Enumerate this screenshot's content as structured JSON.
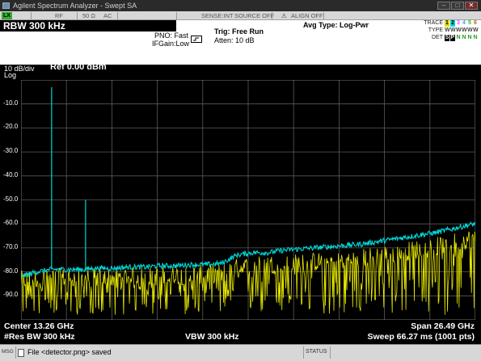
{
  "window": {
    "title": "Agilent Spectrum Analyzer - Swept SA"
  },
  "status_row": {
    "tag": "LX",
    "rf": "RF",
    "impedance": "50 Ω",
    "coupling": "AC",
    "sense": "SENSE:INT",
    "source": "SOURCE OFF",
    "align": "ALIGN OFF"
  },
  "info": {
    "rbw_title": "RBW 300 kHz",
    "pno": "PNO: Fast",
    "ifgain": "IFGain:Low",
    "trig": "Trig: Free Run",
    "atten": "Atten: 10 dB",
    "avg_type": "Avg Type: Log-Pwr",
    "trace_label": "TRACE",
    "type_label": "TYPE",
    "det_label": "DET",
    "trace_digits": [
      "1",
      "2",
      "3",
      "4",
      "5",
      "6"
    ],
    "type_letters": [
      "W",
      "W",
      "W",
      "W",
      "W",
      "W"
    ],
    "det_letters": [
      "S",
      "P",
      "N",
      "N",
      "N",
      "N"
    ],
    "trace_colors": [
      "#e0e000",
      "#00d8d8",
      "#ff40ff",
      "#40a0ff",
      "#20c020",
      "#c06020"
    ]
  },
  "screen": {
    "scale": "10 dB/div",
    "scale_mode": "Log",
    "ref": "Ref 0.00 dBm",
    "yticks": [
      "-10.0",
      "-20.0",
      "-30.0",
      "-40.0",
      "-50.0",
      "-60.0",
      "-70.0",
      "-80.0",
      "-90.0"
    ]
  },
  "footer": {
    "center": "Center 13.26 GHz",
    "res_bw": "#Res BW 300 kHz",
    "vbw": "VBW 300 kHz",
    "span": "Span 26.49 GHz",
    "sweep": "Sweep  66.27 ms (1001 pts)"
  },
  "messages": {
    "msg_label": "MSG",
    "message": "File <detector.png> saved",
    "status_label": "STATUS"
  },
  "chart_data": {
    "type": "line",
    "ylim": [
      -100,
      0
    ],
    "xlim": [
      0.015,
      26.505
    ],
    "x_unit": "GHz",
    "y_unit": "dBm",
    "grid": true,
    "series": [
      {
        "color": "#00d8d8",
        "x": [
          0.015,
          0.9,
          1.8,
          2.7,
          3.6,
          4.5,
          5.4,
          6.3,
          7.2,
          8.1,
          9.0,
          9.9,
          10.8,
          11.7,
          12.6,
          13.5,
          14.4,
          15.3,
          16.2,
          17.1,
          18.0,
          18.9,
          19.8,
          20.7,
          21.6,
          22.5,
          23.4,
          24.3,
          25.2,
          26.1,
          26.505
        ],
        "y": [
          -82,
          -80,
          -79,
          -79,
          -79,
          -78.5,
          -78.5,
          -78,
          -78,
          -77.5,
          -77.5,
          -77,
          -77,
          -76.5,
          -73,
          -72,
          -72,
          -71,
          -70.5,
          -70,
          -69.5,
          -69,
          -68.5,
          -67.5,
          -66.5,
          -65.5,
          -64.5,
          -63.5,
          -62,
          -60.5,
          -60
        ],
        "spikes": [
          {
            "x": 1.8,
            "y": -3
          },
          {
            "x": 3.78,
            "y": -50
          }
        ]
      },
      {
        "color": "#e8e800",
        "x": [
          0.015,
          0.9,
          1.8,
          2.7,
          3.6,
          4.5,
          5.4,
          6.3,
          7.2,
          8.1,
          9.0,
          9.9,
          10.8,
          11.7,
          12.6,
          13.5,
          14.4,
          15.3,
          16.2,
          17.1,
          18.0,
          18.9,
          19.8,
          20.7,
          21.6,
          22.5,
          23.4,
          24.3,
          25.2,
          26.1,
          26.505
        ],
        "y": [
          -85,
          -84.5,
          -84,
          -84,
          -84,
          -84,
          -84,
          -83.5,
          -83.5,
          -83.5,
          -83,
          -83,
          -82.5,
          -82.5,
          -80,
          -79,
          -78.5,
          -78.5,
          -78,
          -77.5,
          -77,
          -76.5,
          -76,
          -75,
          -74,
          -73,
          -72,
          -71,
          -69.5,
          -68,
          -67
        ],
        "noise_floor": -98
      }
    ]
  }
}
